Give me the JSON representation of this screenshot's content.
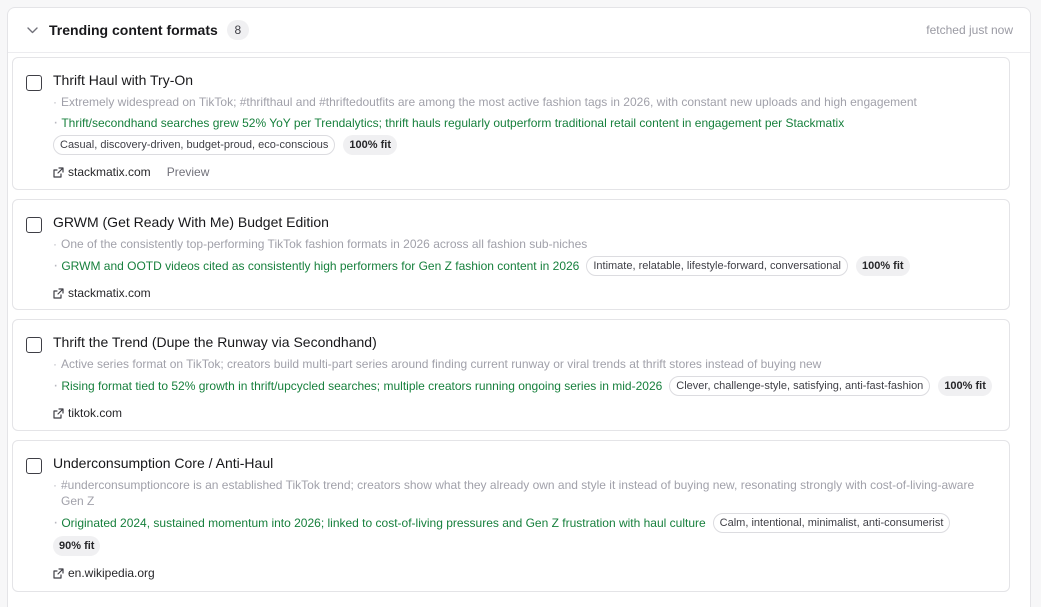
{
  "header": {
    "title": "Trending content formats",
    "count": "8",
    "fetched": "fetched just now"
  },
  "items": [
    {
      "title": "Thrift Haul with Try-On",
      "description": "Extremely widespread on TikTok; #thrifthaul and #thriftedoutfits are among the most active fashion tags in 2026, with constant new uploads and high engagement",
      "evidence": "Thrift/secondhand searches grew 52% YoY per Trendalytics; thrift hauls regularly outperform traditional retail content in engagement per Stackmatix",
      "tone": "Casual, discovery-driven, budget-proud, eco-conscious",
      "fit": "100% fit",
      "source": "stackmatix.com",
      "preview": "Preview"
    },
    {
      "title": "GRWM (Get Ready With Me) Budget Edition",
      "description": "One of the consistently top-performing TikTok fashion formats in 2026 across all fashion sub-niches",
      "evidence": "GRWM and OOTD videos cited as consistently high performers for Gen Z fashion content in 2026",
      "tone": "Intimate, relatable, lifestyle-forward, conversational",
      "fit": "100% fit",
      "source": "stackmatix.com"
    },
    {
      "title": "Thrift the Trend (Dupe the Runway via Secondhand)",
      "description": "Active series format on TikTok; creators build multi-part series around finding current runway or viral trends at thrift stores instead of buying new",
      "evidence": "Rising format tied to 52% growth in thrift/upcycled searches; multiple creators running ongoing series in mid-2026",
      "tone": "Clever, challenge-style, satisfying, anti-fast-fashion",
      "fit": "100% fit",
      "source": "tiktok.com"
    },
    {
      "title": "Underconsumption Core / Anti-Haul",
      "description": "#underconsumptioncore is an established TikTok trend; creators show what they already own and style it instead of buying new, resonating strongly with cost-of-living-aware Gen Z",
      "evidence": "Originated 2024, sustained momentum into 2026; linked to cost-of-living pressures and Gen Z frustration with haul culture",
      "tone": "Calm, intentional, minimalist, anti-consumerist",
      "fit": "90% fit",
      "source": "en.wikipedia.org"
    }
  ]
}
